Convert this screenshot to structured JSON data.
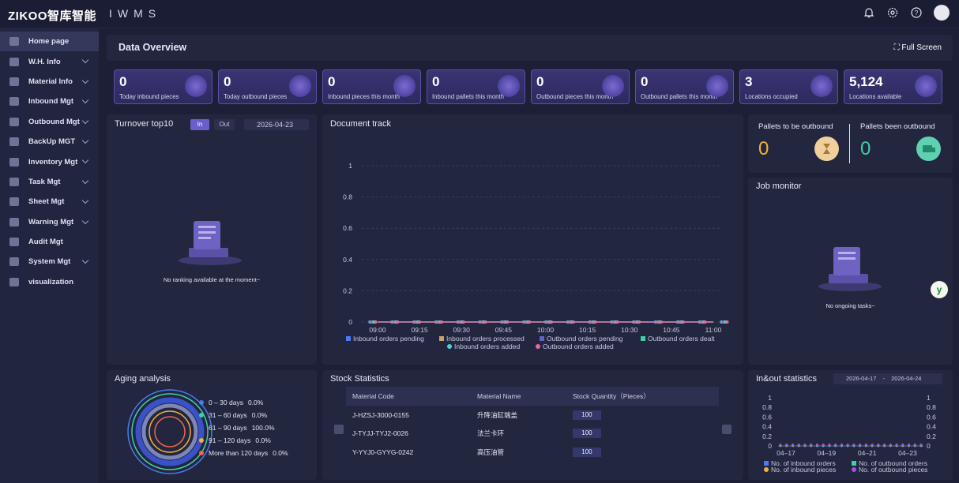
{
  "app": {
    "logo": "ZIKOO智库智能",
    "system_name": "IWMS"
  },
  "topbar": {
    "icons": [
      "bell-icon",
      "gear-icon",
      "help-icon",
      "user-avatar"
    ]
  },
  "sidebar": {
    "items": [
      {
        "label": "Home page",
        "icon": "home-icon",
        "active": true,
        "expandable": false
      },
      {
        "label": "W.H. Info",
        "icon": "warehouse-icon",
        "expandable": true
      },
      {
        "label": "Material Info",
        "icon": "material-icon",
        "expandable": true
      },
      {
        "label": "Inbound Mgt",
        "icon": "truck-in-icon",
        "expandable": true
      },
      {
        "label": "Outbound Mgt",
        "icon": "truck-out-icon",
        "expandable": true
      },
      {
        "label": "BackUp MGT",
        "icon": "box-icon",
        "expandable": true
      },
      {
        "label": "Inventory Mgt",
        "icon": "inventory-icon",
        "expandable": true
      },
      {
        "label": "Task Mgt",
        "icon": "task-icon",
        "expandable": true
      },
      {
        "label": "Sheet Mgt",
        "icon": "sheet-icon",
        "expandable": true
      },
      {
        "label": "Warning Mgt",
        "icon": "warning-icon",
        "expandable": true
      },
      {
        "label": "Audit Mgt",
        "icon": "audit-icon",
        "expandable": false
      },
      {
        "label": "System Mgt",
        "icon": "system-icon",
        "expandable": true
      },
      {
        "label": "visualization",
        "icon": "visualization-icon",
        "expandable": false
      }
    ]
  },
  "header": {
    "title": "Data Overview",
    "fullscreen_label": "Full Screen"
  },
  "kpis": [
    {
      "value": "0",
      "label": "Today inbound pieces"
    },
    {
      "value": "0",
      "label": "Today outbound pieces"
    },
    {
      "value": "0",
      "label": "Inbound pieces this month"
    },
    {
      "value": "0",
      "label": "Inbound pallets this month"
    },
    {
      "value": "0",
      "label": "Outbound pieces this month"
    },
    {
      "value": "0",
      "label": "Outbound pallets this month"
    },
    {
      "value": "3",
      "label": "Locations occupied"
    },
    {
      "value": "5,124",
      "label": "Locations available"
    }
  ],
  "turnover": {
    "title": "Turnover top10",
    "tab_in": "In",
    "tab_out": "Out",
    "date": "2026-04-23",
    "empty_text": "No ranking available at the moment~"
  },
  "document_track": {
    "title": "Document track"
  },
  "pallets": {
    "to_be_outbound_label": "Pallets to be outbound",
    "to_be_outbound_value": "0",
    "been_outbound_label": "Pallets been outbound",
    "been_outbound_value": "0"
  },
  "job_monitor": {
    "title": "Job monitor",
    "empty_text": "No ongoing tasks~"
  },
  "aging": {
    "title": "Aging analysis",
    "buckets": [
      {
        "label": "0 – 30 days",
        "pct": "0.0%",
        "color": "#4a7bf0"
      },
      {
        "label": "31 – 60 days",
        "pct": "0.0%",
        "color": "#3ecfa2"
      },
      {
        "label": "61 – 90 days",
        "pct": "100.0%",
        "color": "#3a52c8"
      },
      {
        "label": "91 – 120 days",
        "pct": "0.0%",
        "color": "#f3b234"
      },
      {
        "label": "More than 120 days",
        "pct": "0.0%",
        "color": "#f0664a"
      }
    ]
  },
  "stock": {
    "title": "Stock Statistics",
    "columns": [
      "Material Code",
      "Material Name",
      "Stock Quantity（Pieces）"
    ],
    "rows": [
      {
        "code": "J-HZSJ-3000-0155",
        "name": "升降油缸端盖",
        "qty": "100"
      },
      {
        "code": "J-TYJJ-TYJ2-0026",
        "name": "法兰卡环",
        "qty": "100"
      },
      {
        "code": "Y-YYJ0-GYYG-0242",
        "name": "高压油管",
        "qty": "100"
      }
    ]
  },
  "inout": {
    "title": "In&out statistics",
    "date_from": "2026-04-17",
    "date_sep": "-",
    "date_to": "2026-04-24"
  },
  "chart_data": [
    {
      "type": "line",
      "title": "Document track",
      "x": [
        "09:00",
        "09:15",
        "09:30",
        "09:45",
        "10:00",
        "10:15",
        "10:30",
        "10:45",
        "11:00"
      ],
      "ylim": [
        0,
        1
      ],
      "yticks": [
        "0",
        "0.2",
        "0.4",
        "0.6",
        "0.8",
        "1"
      ],
      "grid": true,
      "legend_position": "bottom",
      "series": [
        {
          "name": "Inbound orders pending",
          "values": [
            0,
            0,
            0,
            0,
            0,
            0,
            0,
            0,
            0
          ],
          "color": "#4a7bf0"
        },
        {
          "name": "Inbound orders processed",
          "values": [
            0,
            0,
            0,
            0,
            0,
            0,
            0,
            0,
            0
          ],
          "color": "#c9a36a"
        },
        {
          "name": "Outbound orders pending",
          "values": [
            0,
            0,
            0,
            0,
            0,
            0,
            0,
            0,
            0
          ],
          "color": "#5f62c8"
        },
        {
          "name": "Outbound orders dealt",
          "values": [
            0,
            0,
            0,
            0,
            0,
            0,
            0,
            0,
            0
          ],
          "color": "#3ecfa2"
        },
        {
          "name": "Inbound orders added",
          "values": [
            0,
            0,
            0,
            0,
            0,
            0,
            0,
            0,
            0
          ],
          "color": "#46d6d6"
        },
        {
          "name": "Outbound orders added",
          "values": [
            0,
            0,
            0,
            0,
            0,
            0,
            0,
            0,
            0
          ],
          "color": "#e46aa6"
        }
      ]
    },
    {
      "type": "line",
      "title": "In&out statistics",
      "x": [
        "04–17",
        "04–19",
        "04–21",
        "04–23"
      ],
      "ylim": [
        0,
        1
      ],
      "yticks": [
        "0",
        "0.2",
        "0.4",
        "0.6",
        "0.8",
        "1"
      ],
      "grid": false,
      "legend_position": "bottom",
      "series": [
        {
          "name": "No. of inbound orders",
          "values": [
            0,
            0,
            0,
            0
          ],
          "color": "#4a7bf0"
        },
        {
          "name": "No. of outbound orders",
          "values": [
            0,
            0,
            0,
            0
          ],
          "color": "#3ecfa2"
        },
        {
          "name": "No. of inbound pieces",
          "values": [
            0,
            0,
            0,
            0
          ],
          "color": "#f3b234"
        },
        {
          "name": "No. of outbound pieces",
          "values": [
            0,
            0,
            0,
            0
          ],
          "color": "#a452e0"
        }
      ]
    }
  ]
}
